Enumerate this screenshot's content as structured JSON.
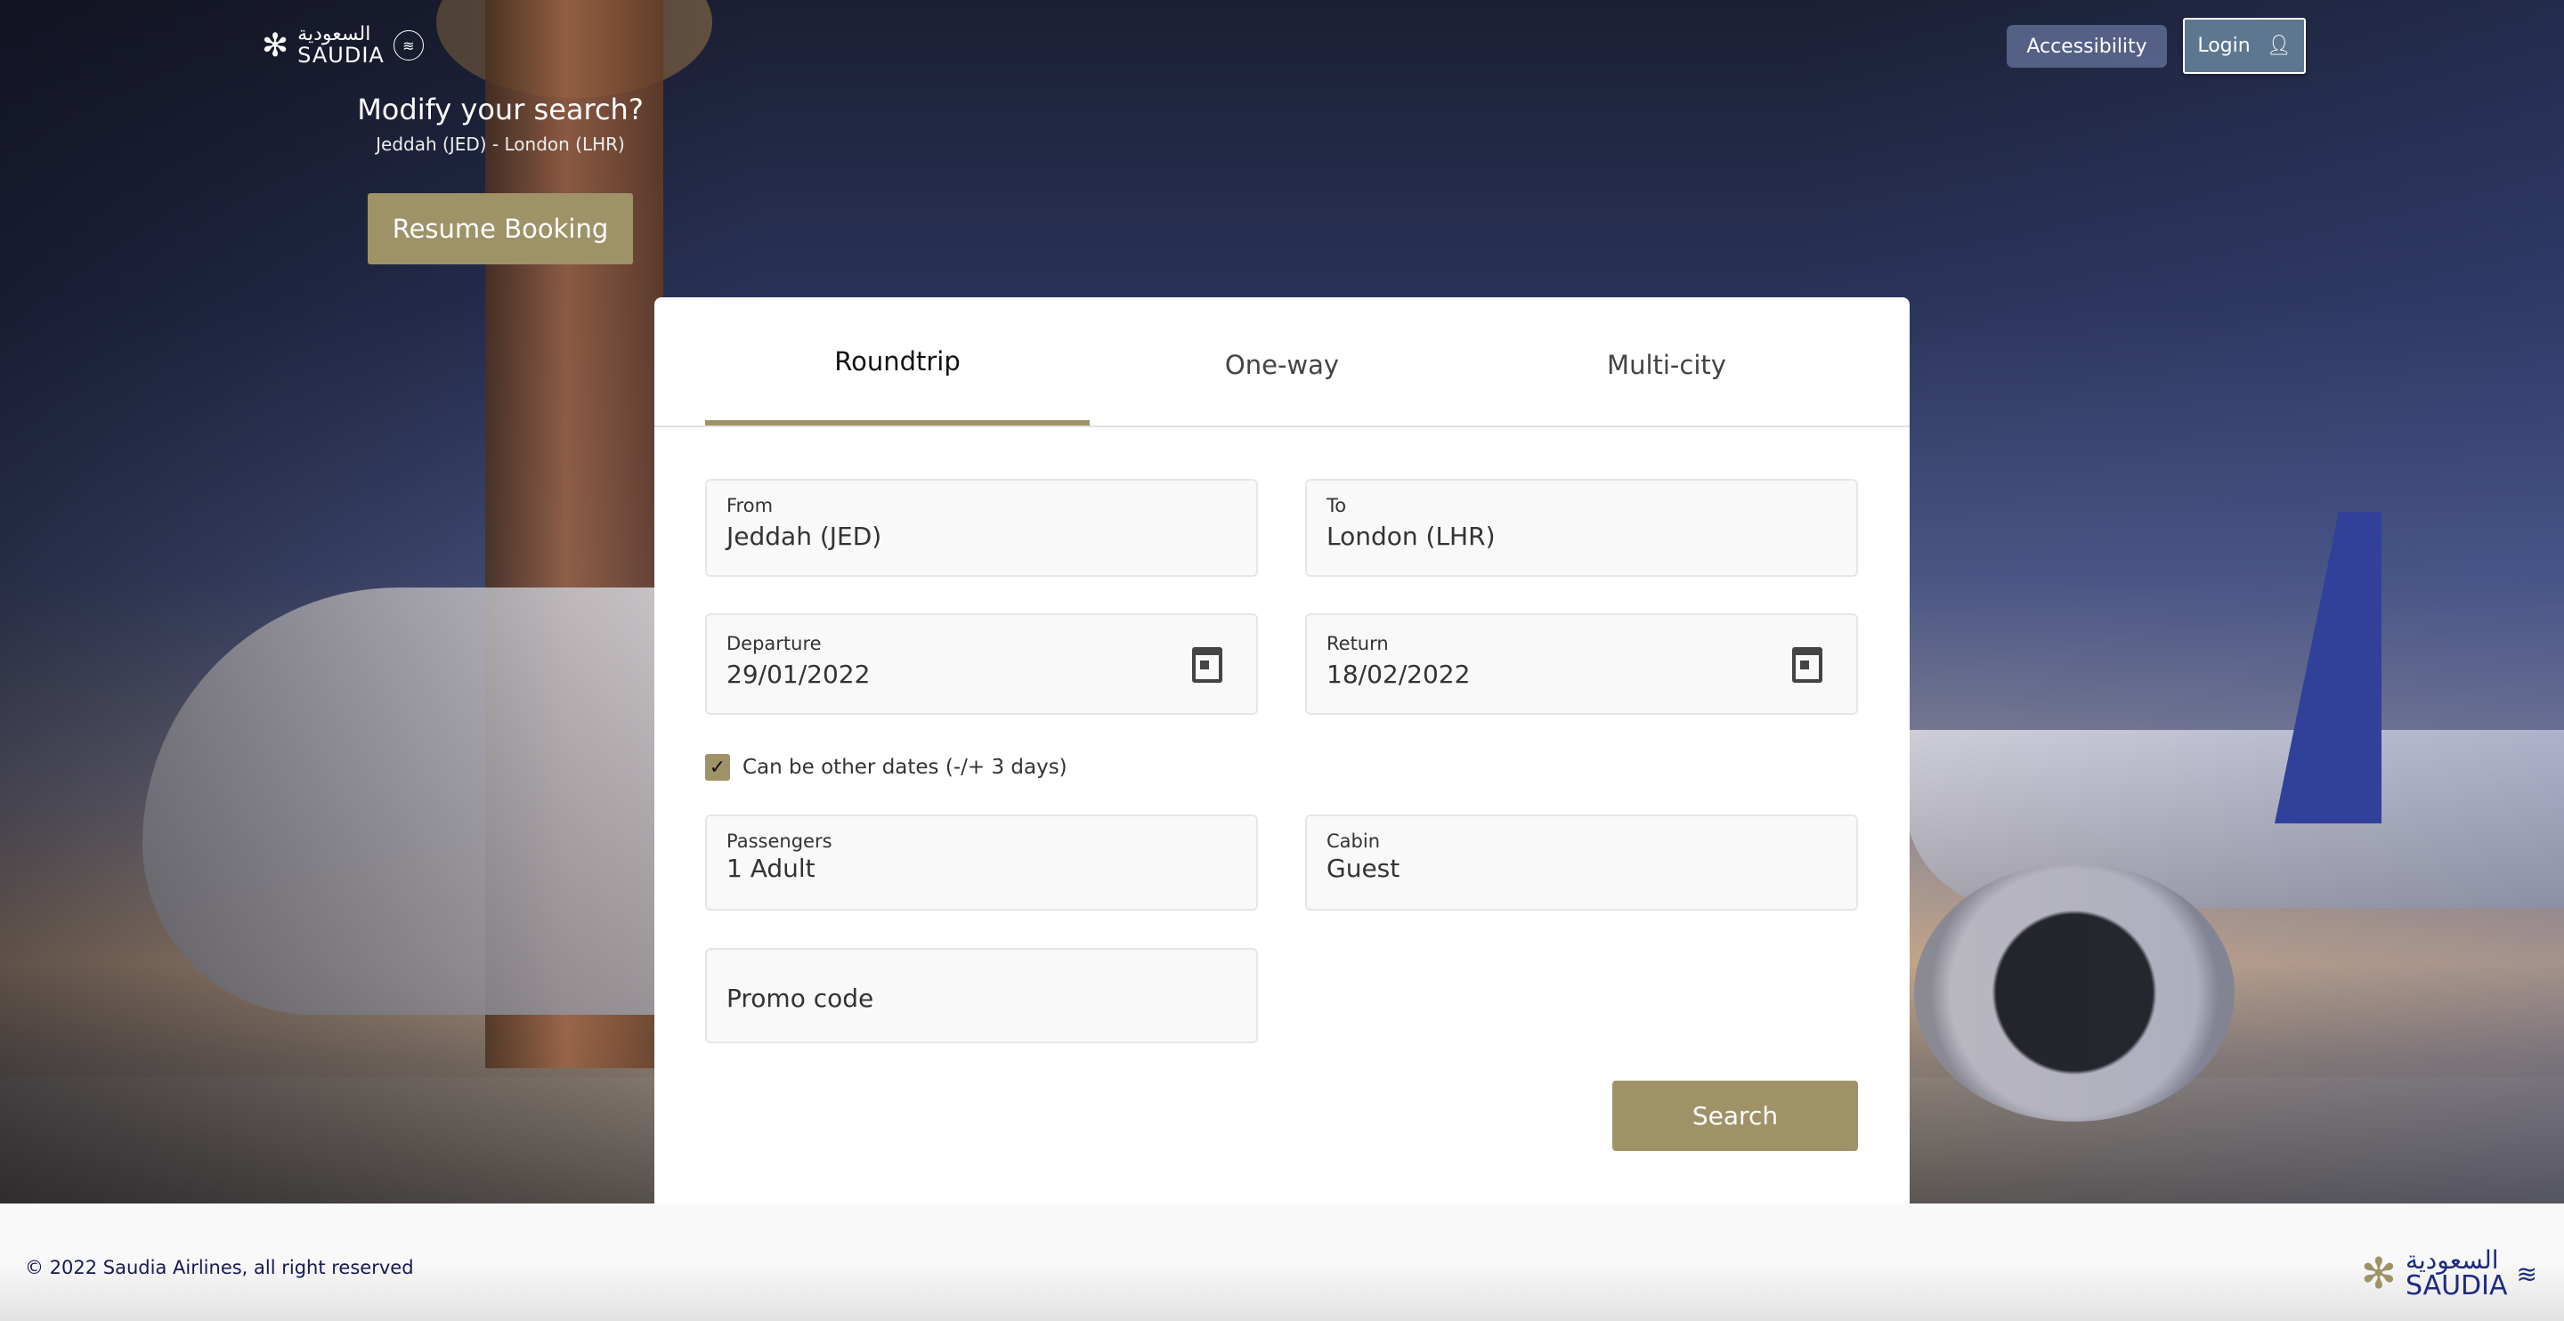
{
  "header": {
    "logo_text_ar": "السعودية",
    "logo_text_en": "SAUDIA",
    "accessibility_label": "Accessibility",
    "login_label": "Login"
  },
  "hero": {
    "title": "Modify your search?",
    "route": "Jeddah (JED) - London (LHR)",
    "resume_label": "Resume Booking"
  },
  "tabs": [
    {
      "label": "Roundtrip",
      "active": true
    },
    {
      "label": "One-way",
      "active": false
    },
    {
      "label": "Multi-city",
      "active": false
    }
  ],
  "form": {
    "from": {
      "label": "From",
      "value": "Jeddah (JED)"
    },
    "to": {
      "label": "To",
      "value": "London (LHR)"
    },
    "departure": {
      "label": "Departure",
      "value": "29/01/2022"
    },
    "return": {
      "label": "Return",
      "value": "18/02/2022"
    },
    "flexible": {
      "label": "Can be other dates (-/+ 3 days)",
      "checked": true
    },
    "passengers": {
      "label": "Passengers",
      "value": "1 Adult"
    },
    "cabin": {
      "label": "Cabin",
      "value": "Guest"
    },
    "promo": {
      "placeholder": "Promo code"
    },
    "search_label": "Search"
  },
  "footer": {
    "copyright": "© 2022 Saudia Airlines, all right reserved",
    "logo_text_ar": "السعودية",
    "logo_text_en": "SAUDIA"
  },
  "colors": {
    "accent": "#a09267",
    "footer_text": "#15194f"
  }
}
